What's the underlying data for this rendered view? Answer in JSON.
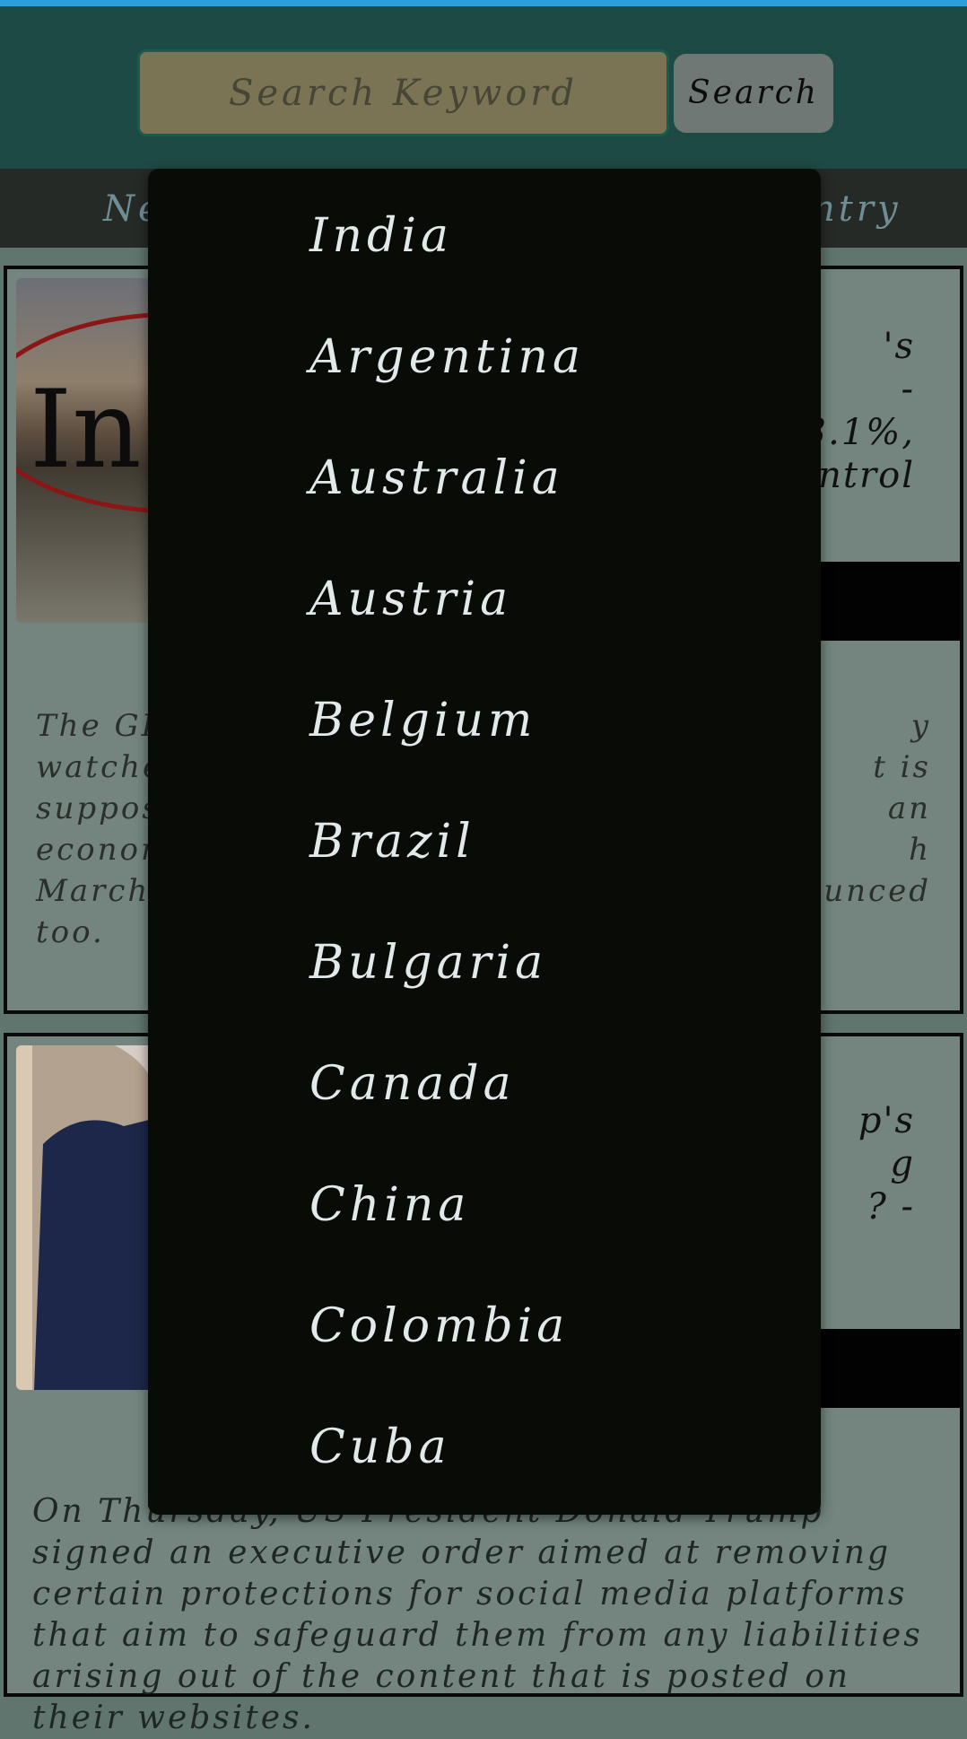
{
  "search": {
    "placeholder": "Search Keyword",
    "button_label": "Search"
  },
  "navbar": {
    "left_label_fragment": "Ne",
    "right_label_fragment": "ntry"
  },
  "articles": [
    {
      "title_fragments": [
        "'s",
        "-",
        "3.1%,",
        "ntrol"
      ],
      "image_text_fragment": "In",
      "desc_left": [
        "The GD",
        "watche",
        "suppos",
        "econom",
        "March,",
        "too."
      ],
      "desc_right": [
        "y",
        "t is",
        "an",
        "h",
        "ounced"
      ]
    },
    {
      "title_fragments": [
        "p's",
        "g",
        "? -"
      ]
    }
  ],
  "dropdown": {
    "items": [
      "India",
      "Argentina",
      "Australia",
      "Austria",
      "Belgium",
      "Brazil",
      "Bulgaria",
      "Canada",
      "China",
      "Colombia",
      "Cuba"
    ]
  },
  "bottom_text": "On Thursday, US President Donald Trump signed an executive order aimed at removing certain protections for social media platforms that aim to safeguard them from any liabilities arising out of the content that is posted on their websites."
}
